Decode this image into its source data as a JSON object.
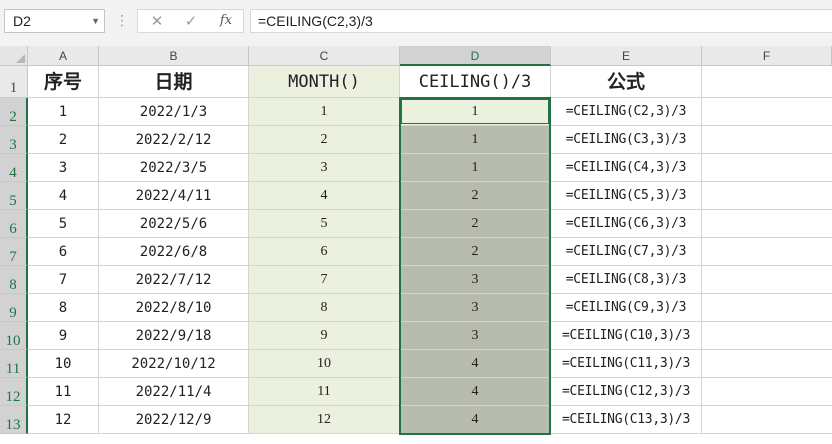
{
  "formula_bar": {
    "name_box": "D2",
    "dots": "⋮",
    "cancel_icon": "✕",
    "enter_icon": "✓",
    "fx_label": "fx",
    "formula": "=CEILING(C2,3)/3"
  },
  "columns": [
    "A",
    "B",
    "C",
    "D",
    "E",
    "F"
  ],
  "selected_column": "D",
  "active_cell": "D2",
  "header_row": {
    "row_number": "1",
    "cells": [
      "序号",
      "日期",
      "MONTH()",
      "CEILING()/3",
      "公式"
    ]
  },
  "rows": [
    {
      "row_number": "2",
      "cells": [
        "1",
        "2022/1/3",
        "1",
        "1",
        "=CEILING(C2,3)/3"
      ]
    },
    {
      "row_number": "3",
      "cells": [
        "2",
        "2022/2/12",
        "2",
        "1",
        "=CEILING(C3,3)/3"
      ]
    },
    {
      "row_number": "4",
      "cells": [
        "3",
        "2022/3/5",
        "3",
        "1",
        "=CEILING(C4,3)/3"
      ]
    },
    {
      "row_number": "5",
      "cells": [
        "4",
        "2022/4/11",
        "4",
        "2",
        "=CEILING(C5,3)/3"
      ]
    },
    {
      "row_number": "6",
      "cells": [
        "5",
        "2022/5/6",
        "5",
        "2",
        "=CEILING(C6,3)/3"
      ]
    },
    {
      "row_number": "7",
      "cells": [
        "6",
        "2022/6/8",
        "6",
        "2",
        "=CEILING(C7,3)/3"
      ]
    },
    {
      "row_number": "8",
      "cells": [
        "7",
        "2022/7/12",
        "7",
        "3",
        "=CEILING(C8,3)/3"
      ]
    },
    {
      "row_number": "9",
      "cells": [
        "8",
        "2022/8/10",
        "8",
        "3",
        "=CEILING(C9,3)/3"
      ]
    },
    {
      "row_number": "10",
      "cells": [
        "9",
        "2022/9/18",
        "9",
        "3",
        "=CEILING(C10,3)/3"
      ]
    },
    {
      "row_number": "11",
      "cells": [
        "10",
        "2022/10/12",
        "10",
        "4",
        "=CEILING(C11,3)/3"
      ]
    },
    {
      "row_number": "12",
      "cells": [
        "11",
        "2022/11/4",
        "11",
        "4",
        "=CEILING(C12,3)/3"
      ]
    },
    {
      "row_number": "13",
      "cells": [
        "12",
        "2022/12/9",
        "12",
        "4",
        "=CEILING(C13,3)/3"
      ]
    }
  ],
  "colors": {
    "accent": "#217346",
    "fill_month_column": "#ebf1de",
    "fill_selected_range": "#b8bcae",
    "header_bg": "#e9e9e9"
  }
}
